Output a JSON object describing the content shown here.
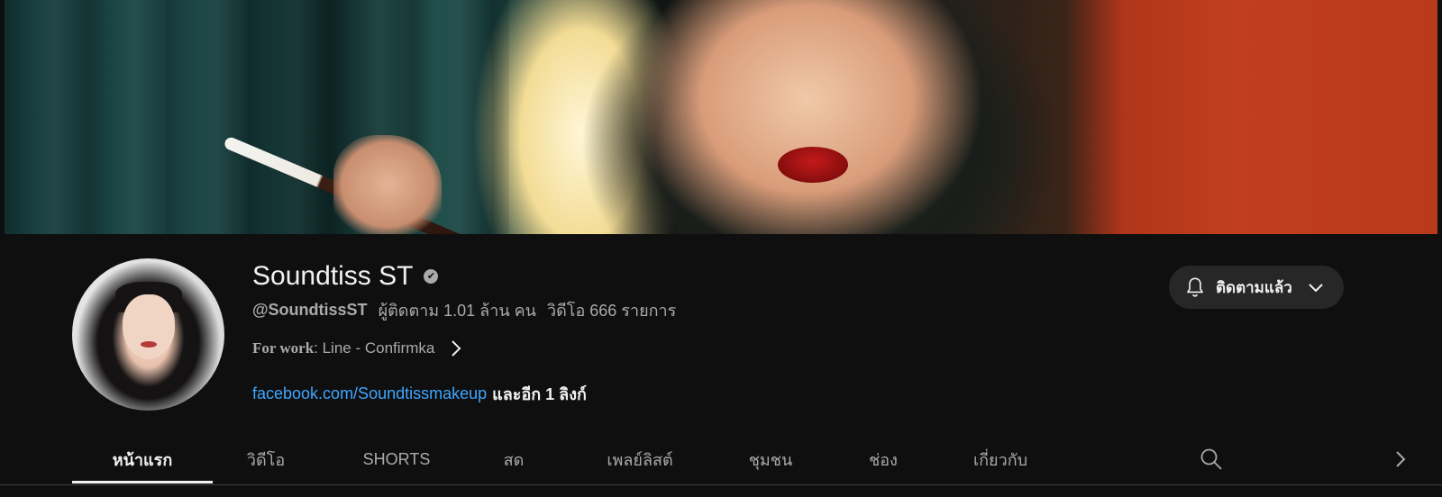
{
  "channel": {
    "name": "Soundtiss ST",
    "verified_mark": "✔",
    "handle": "@SoundtissST",
    "subscribers": "ผู้ติดตาม 1.01 ล้าน คน",
    "videos": "วิดีโอ 666 รายการ",
    "description_bold": "For work",
    "description_rest": " : Line - Confirmka",
    "link": "facebook.com/Soundtissmakeup",
    "more_links": "และอีก 1 ลิงก์"
  },
  "subscribe": {
    "label": "ติดตามแล้ว",
    "bell_icon": "bell-icon",
    "chevron_icon": "chevron-down-icon"
  },
  "tabs": [
    {
      "label": "หน้าแรก",
      "active": true
    },
    {
      "label": "วิดีโอ",
      "active": false
    },
    {
      "label": "SHORTS",
      "active": false
    },
    {
      "label": "สด",
      "active": false
    },
    {
      "label": "เพลย์ลิสต์",
      "active": false
    },
    {
      "label": "ชุมชน",
      "active": false
    },
    {
      "label": "ช่อง",
      "active": false
    },
    {
      "label": "เกี่ยวกับ",
      "active": false
    }
  ],
  "colors": {
    "background": "#0f0f0f",
    "text_primary": "#f1f1f1",
    "text_secondary": "#aaaaaa",
    "link": "#3ea6ff",
    "button_bg": "#272727"
  }
}
